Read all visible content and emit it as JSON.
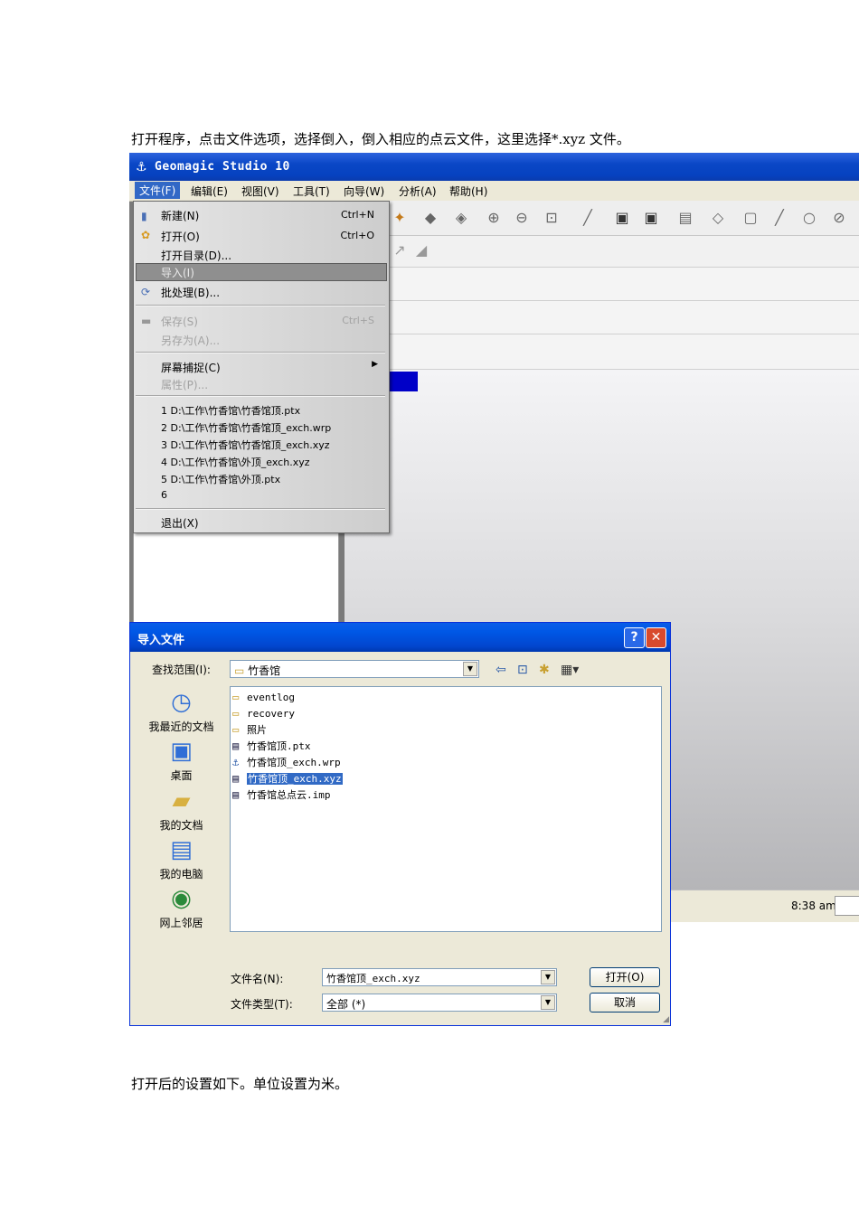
{
  "paragraphs": {
    "p1": "打开程序，点击文件选项，选择倒入，倒入相应的点云文件，这里选择*.xyz 文件。",
    "p2": "打开后的设置如下。单位设置为米。"
  },
  "app": {
    "title": "Geomagic Studio 10",
    "menu": [
      "文件(F)",
      "编辑(E)",
      "视图(V)",
      "工具(T)",
      "向导(W)",
      "分析(A)",
      "帮助(H)"
    ],
    "status_time": "8:38 am"
  },
  "file_menu": {
    "new": {
      "label": "新建(N)",
      "shortcut": "Ctrl+N"
    },
    "open": {
      "label": "打开(O)",
      "shortcut": "Ctrl+O"
    },
    "open_dir": "打开目录(D)...",
    "import": "导入(I)",
    "batch": "批处理(B)...",
    "save": {
      "label": "保存(S)",
      "shortcut": "Ctrl+S"
    },
    "save_as": "另存为(A)...",
    "screen_capture": "屏幕捕捉(C)",
    "properties": "属性(P)...",
    "recent": [
      "1 D:\\工作\\竹香馆\\竹香馆顶.ptx",
      "2 D:\\工作\\竹香馆\\竹香馆顶_exch.wrp",
      "3 D:\\工作\\竹香馆\\竹香馆顶_exch.xyz",
      "4 D:\\工作\\竹香馆\\外顶_exch.xyz",
      "5 D:\\工作\\竹香馆\\外顶.ptx",
      "6"
    ],
    "exit": "退出(X)"
  },
  "dialog": {
    "title": "导入文件",
    "look_in_label": "查找范围(I):",
    "look_in_value": "竹香馆",
    "places": [
      "我最近的文档",
      "桌面",
      "我的文档",
      "我的电脑",
      "网上邻居"
    ],
    "files": [
      "eventlog",
      "recovery",
      "照片",
      "竹香馆顶.ptx",
      "竹香馆顶_exch.wrp",
      "竹香馆顶_exch.xyz",
      "竹香馆总点云.imp"
    ],
    "filename_label": "文件名(N):",
    "filename_value": "竹香馆顶_exch.xyz",
    "filetype_label": "文件类型(T):",
    "filetype_value": "全部 (*)",
    "open_button": "打开(O)",
    "cancel_button": "取消"
  }
}
